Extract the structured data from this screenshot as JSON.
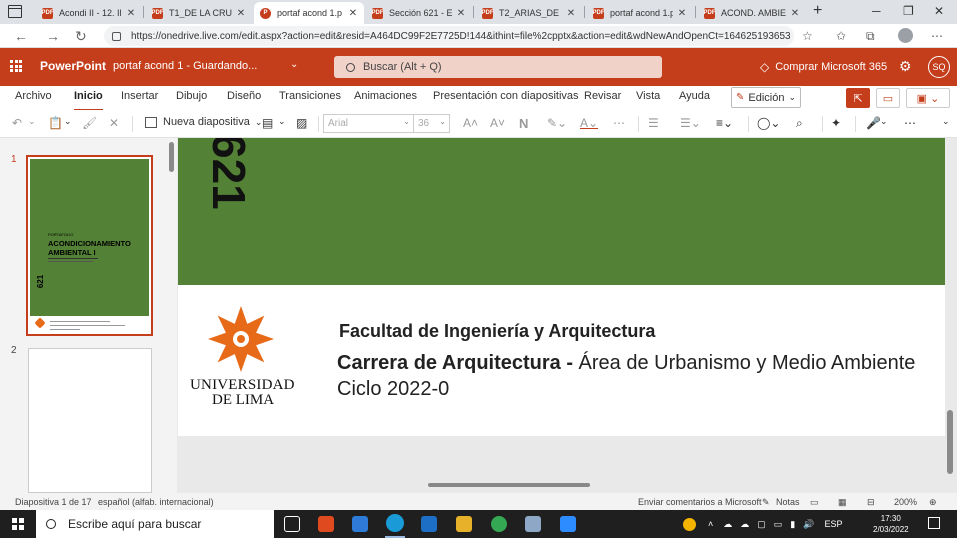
{
  "browser": {
    "tabs": [
      {
        "title": "Acondi II - 12. Ilu",
        "favicon": "PDF"
      },
      {
        "title": "T1_DE LA CRUZ_L",
        "favicon": "PDF"
      },
      {
        "title": "portaf acond 1.p",
        "favicon": "P",
        "active": true
      },
      {
        "title": "Sección 621 - Exi",
        "favicon": "PDF"
      },
      {
        "title": "T2_ARIAS_DE LA",
        "favicon": "PDF"
      },
      {
        "title": "portaf acond 1.p",
        "favicon": "PDF"
      },
      {
        "title": "ACOND. AMBIEN",
        "favicon": "PDF"
      }
    ],
    "new_tab_glyph": "+",
    "url": "https://onedrive.live.com/edit.aspx?action=edit&resid=A464DC99F2E7725D!144&ithint=file%2cpptx&action=edit&wdNewAndOpenCt=164625193653..."
  },
  "app": {
    "name": "PowerPoint",
    "doc_status": "portaf acond 1 - Guardando...",
    "search_placeholder": "Buscar (Alt + Q)",
    "buy_label": "Comprar Microsoft 365",
    "user_initials": "SQ",
    "brand_color": "#c43e1c"
  },
  "ribbon": {
    "tabs": [
      "Archivo",
      "Inicio",
      "Insertar",
      "Dibujo",
      "Diseño",
      "Transiciones",
      "Animaciones",
      "Presentación con diapositivas",
      "Revisar",
      "Vista",
      "Ayuda"
    ],
    "active_tab": "Inicio",
    "mode_label": "Edición",
    "new_slide_label": "Nueva diapositiva",
    "font_name": "Arial",
    "font_size": "36"
  },
  "thumbnails": {
    "numbers": [
      "1",
      "2"
    ],
    "thumb1_portfolio": "PORTAFOLIO",
    "thumb1_title": "ACONDICIONAMIENTO AMBIENTAL I",
    "thumb1_section": "621"
  },
  "slide": {
    "section_number": "621",
    "university_line1": "UNIVERSIDAD",
    "university_line2": "DE LIMA",
    "faculty": "Facultad de Ingeniería y Arquitectura",
    "career_bold": "Carrera de Arquitectura -",
    "career_rest": " Área de Urbanismo y Medio Ambiente",
    "cycle": "Ciclo 2022-0",
    "green": "#538135",
    "logo_orange": "#e76a19"
  },
  "status": {
    "slide_info": "Diapositiva 1 de 17",
    "language": "español (alfab. internacional)",
    "feedback": "Enviar comentarios a Microsoft",
    "notes": "Notas",
    "zoom": "200%"
  },
  "taskbar": {
    "search_placeholder": "Escribe aquí para buscar",
    "language": "ESP",
    "time": "17:30",
    "date": "2/03/2022"
  }
}
